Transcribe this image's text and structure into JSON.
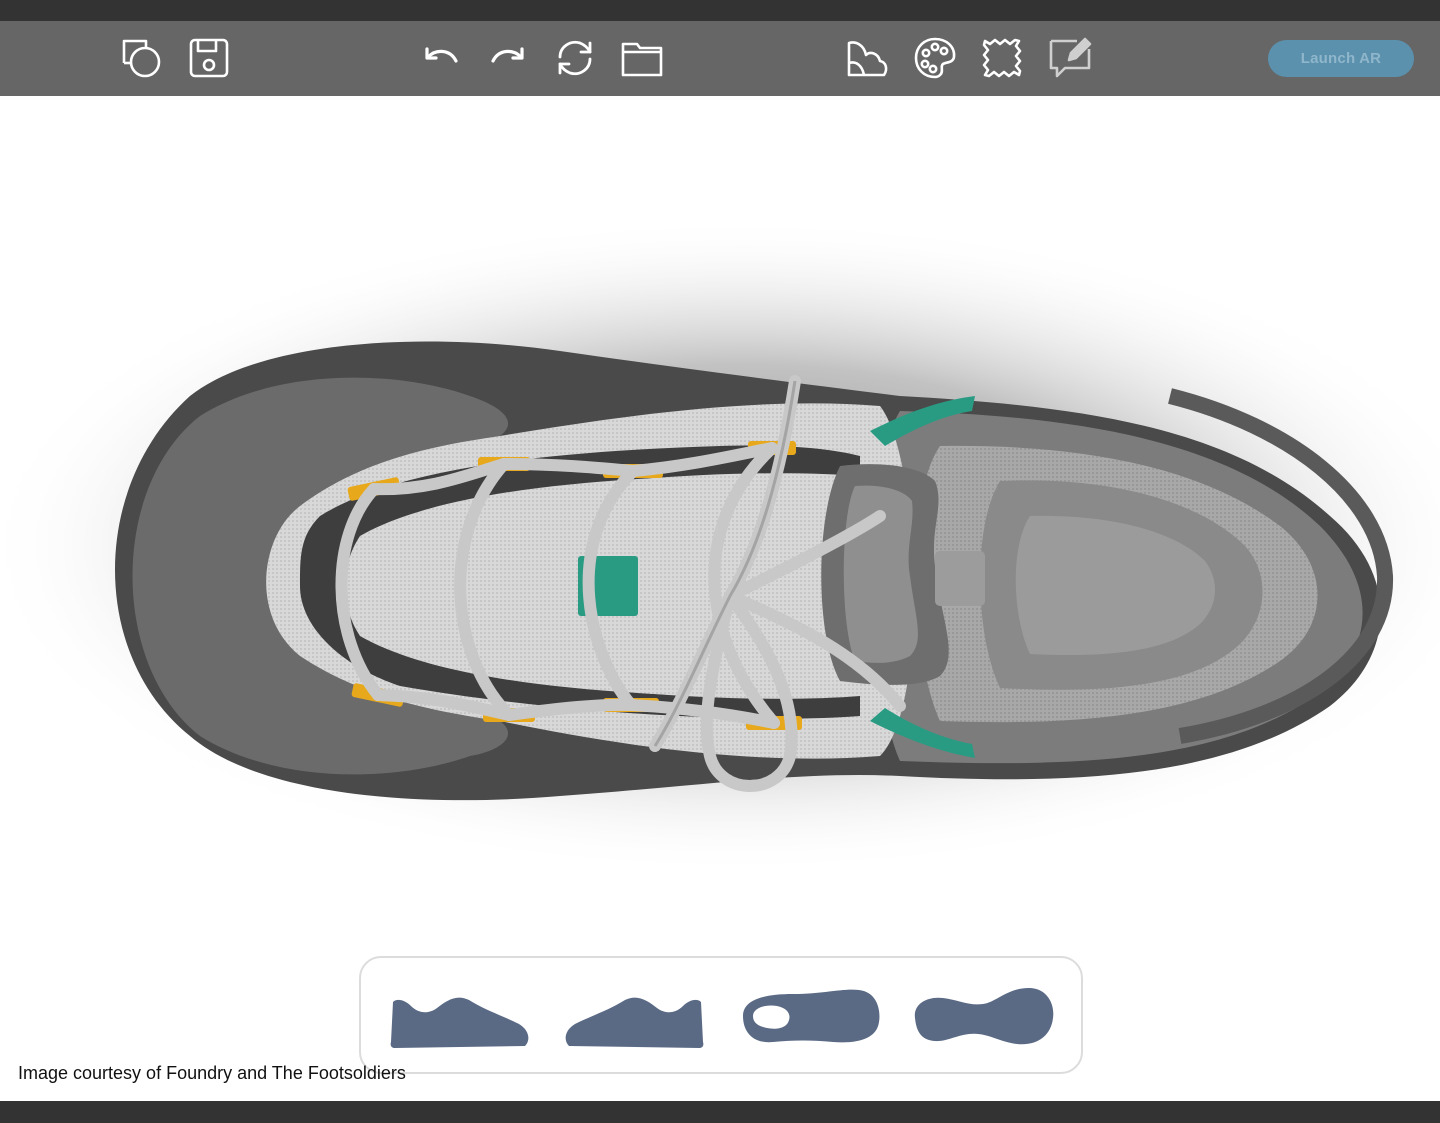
{
  "toolbar": {
    "left_group": [
      {
        "icon": "duplicate-icon"
      },
      {
        "icon": "save-icon"
      }
    ],
    "edit_group": [
      {
        "icon": "undo-icon"
      },
      {
        "icon": "redo-icon"
      },
      {
        "icon": "refresh-icon"
      },
      {
        "icon": "folder-icon"
      }
    ],
    "design_group": [
      {
        "icon": "materials-icon"
      },
      {
        "icon": "palette-icon"
      },
      {
        "icon": "stitch-patch-icon"
      },
      {
        "icon": "annotate-icon"
      }
    ],
    "launch_ar_label": "Launch AR",
    "launch_ar_color": "#5b91ad"
  },
  "views": [
    {
      "icon": "side-view-left-icon"
    },
    {
      "icon": "side-view-right-icon"
    },
    {
      "icon": "top-view-icon"
    },
    {
      "icon": "bottom-view-icon"
    }
  ],
  "view_icon_color": "#5a6a85",
  "accent_colors": {
    "eyelet": "#e8a81c",
    "teal": "#2a9b83"
  },
  "credit": "Image courtesy of Foundry and The Footsoldiers"
}
